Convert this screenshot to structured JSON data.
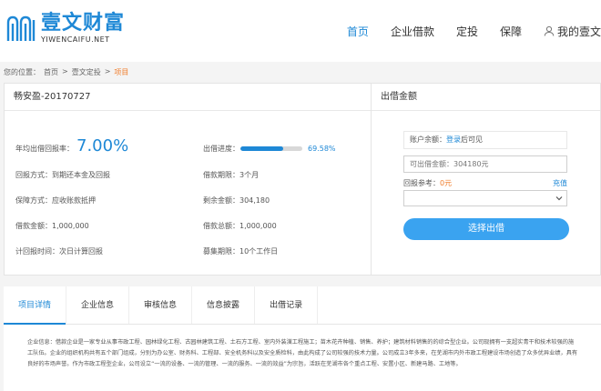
{
  "header": {
    "logo_cn": "壹文财富",
    "logo_en": "YIWENCAIFU.NET",
    "nav": [
      {
        "label": "首页"
      },
      {
        "label": "企业借款"
      },
      {
        "label": "定投"
      },
      {
        "label": "保障"
      },
      {
        "label": "我的壹文"
      }
    ],
    "brand_color": "#1e88d6"
  },
  "breadcrumb": {
    "prefix": "您的位置：",
    "items": [
      "首页",
      ">",
      "壹文定投",
      ">",
      "项目"
    ]
  },
  "project": {
    "title": "畅安盈-20170727",
    "rate_label": "年均出借回报率：",
    "rate_value": "7.00%",
    "progress_label": "出借进度：",
    "progress_percent": 69.58,
    "progress_text": "69.58%",
    "return_method": "回报方式：到期还本金及回报",
    "term": "借款期限：3个月",
    "guarantee": "保障方式：应收账款抵押",
    "remaining": "剩余金额：304,180",
    "borrow_amount": "借款金额：1,000,000",
    "total_amount": "借款总额：1,000,000",
    "interest_start": "计回报时间：次日计算回报",
    "raise_period": "募集期限：10个工作日"
  },
  "invest": {
    "title": "出借金额",
    "balance_prefix": "账户余额：",
    "login_link": "登录",
    "balance_suffix": "后可见",
    "amount_placeholder": "可出借金额：304180元",
    "ref_label": "回报参考：",
    "ref_value": "0元",
    "recharge": "充值",
    "button": "选择出借"
  },
  "tabs": [
    {
      "label": "项目详情"
    },
    {
      "label": "企业信息"
    },
    {
      "label": "审核信息"
    },
    {
      "label": "信息披露"
    },
    {
      "label": "出借记录"
    }
  ],
  "content": {
    "text": "企业信息：借款企业是一家专业从事市政工程、园林绿化工程、古园林建筑工程、土石方工程、室内外装潢工程施工；苗木花卉种植、销售、养护；建筑材料销售的的综合型企业。公司现拥有一支超实青干和技术较强的施工队伍。企业的组织机构共有五个部门组成，分别为办公室、财务科、工程部、安全机务科以及安全质检科，由此构成了公司较强的技术力量。公司成立3年多来，在芜湖市内外市政工程建设市场创造了众多优异业绩，具有良好的市场声誉。作为市政工程型企业，公司设立“一流的设备、一流的管理、一流的服务、一流的效益”为宗旨，活跃在芜湖市各个重点工程、安置小区、新建马路、工地等。"
  }
}
